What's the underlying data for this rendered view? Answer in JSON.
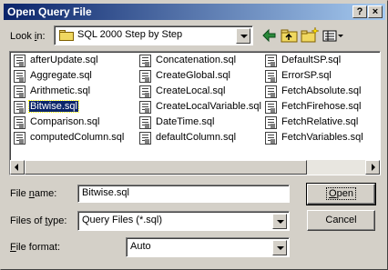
{
  "window": {
    "title": "Open Query File",
    "help_label": "?",
    "close_label": "×"
  },
  "lookin": {
    "label_pre": "Look ",
    "label_key": "i",
    "label_post": "n:",
    "value": "SQL 2000 Step by Step"
  },
  "toolbar": {
    "icons": [
      "back-arrow-icon",
      "up-folder-icon",
      "new-folder-icon",
      "view-menu-icon"
    ]
  },
  "files": {
    "col1": [
      "afterUpdate.sql",
      "Aggregate.sql",
      "Arithmetic.sql",
      "Bitwise.sql",
      "Comparison.sql",
      "computedColumn.sql"
    ],
    "col2": [
      "Concatenation.sql",
      "CreateGlobal.sql",
      "CreateLocal.sql",
      "CreateLocalVariable.sql",
      "DateTime.sql",
      "defaultColumn.sql"
    ],
    "col3": [
      "DefaultSP.sql",
      "ErrorSP.sql",
      "FetchAbsolute.sql",
      "FetchFirehose.sql",
      "FetchRelative.sql",
      "FetchVariables.sql"
    ],
    "selected": "Bitwise.sql"
  },
  "filename": {
    "label_pre": "File ",
    "label_key": "n",
    "label_post": "ame:",
    "value": "Bitwise.sql"
  },
  "filetype": {
    "label_pre": "Files of ",
    "label_key": "t",
    "label_post": "ype:",
    "value": "Query Files (*.sql)"
  },
  "fileformat": {
    "label_pre": "",
    "label_key": "F",
    "label_post": "ile format:",
    "value": "Auto"
  },
  "buttons": {
    "open_key": "O",
    "open_rest": "pen",
    "cancel": "Cancel"
  }
}
